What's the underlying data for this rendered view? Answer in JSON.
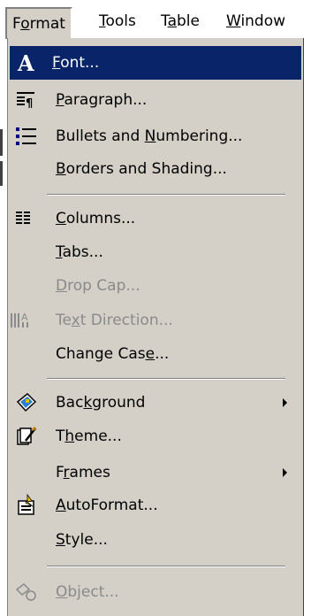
{
  "menubar": {
    "items": [
      {
        "label_pre": "F",
        "label_ul": "o",
        "label_post": "rmat"
      },
      {
        "label_pre": "",
        "label_ul": "T",
        "label_post": "ools"
      },
      {
        "label_pre": "T",
        "label_ul": "a",
        "label_post": "ble"
      },
      {
        "label_pre": "",
        "label_ul": "W",
        "label_post": "indow"
      }
    ]
  },
  "menu": {
    "items": [
      {
        "pre": "",
        "ul": "F",
        "post": "ont...",
        "icon": "font-icon"
      },
      {
        "pre": "",
        "ul": "P",
        "post": "aragraph...",
        "icon": "paragraph-icon"
      },
      {
        "pre": "Bullets and ",
        "ul": "N",
        "post": "umbering...",
        "icon": "bullets-icon"
      },
      {
        "pre": "",
        "ul": "B",
        "post": "orders and Shading...",
        "icon": ""
      },
      {
        "pre": "",
        "ul": "C",
        "post": "olumns...",
        "icon": "columns-icon"
      },
      {
        "pre": "",
        "ul": "T",
        "post": "abs...",
        "icon": ""
      },
      {
        "pre": "",
        "ul": "D",
        "post": "rop Cap...",
        "icon": ""
      },
      {
        "pre": "Te",
        "ul": "x",
        "post": "t Direction...",
        "icon": "text-direction-icon"
      },
      {
        "pre": "Change Cas",
        "ul": "e",
        "post": "...",
        "icon": ""
      },
      {
        "pre": "Bac",
        "ul": "k",
        "post": "ground",
        "icon": "background-icon"
      },
      {
        "pre": "T",
        "ul": "h",
        "post": "eme...",
        "icon": "theme-icon"
      },
      {
        "pre": "F",
        "ul": "r",
        "post": "ames",
        "icon": ""
      },
      {
        "pre": "",
        "ul": "A",
        "post": "utoFormat...",
        "icon": "autoformat-icon"
      },
      {
        "pre": "",
        "ul": "S",
        "post": "tyle...",
        "icon": ""
      },
      {
        "pre": "",
        "ul": "O",
        "post": "bject...",
        "icon": "object-icon"
      }
    ]
  },
  "colors": {
    "menu_bg": "#d4d0c8",
    "highlight": "#0a246a",
    "disabled": "#808080"
  }
}
